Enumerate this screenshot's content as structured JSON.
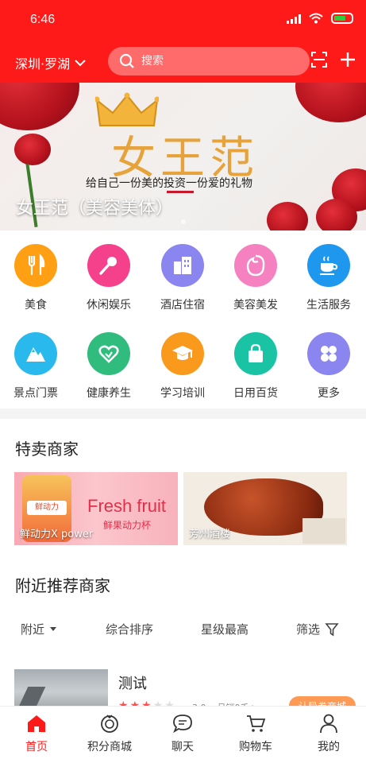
{
  "status": {
    "time": "6:46"
  },
  "header": {
    "city": "深圳·罗湖",
    "search_placeholder": "搜索",
    "icons": [
      "scan-icon",
      "plus-icon"
    ]
  },
  "banner": {
    "headline": "女王范",
    "slogan": "给自己一份美的投资一份爱的礼物",
    "caption": "女王范（美容美体）"
  },
  "categories": [
    {
      "label": "美食",
      "icon": "fork-knife-icon",
      "color": "#ff9f14"
    },
    {
      "label": "休闲娱乐",
      "icon": "microphone-icon",
      "color": "#f5418b"
    },
    {
      "label": "酒店住宿",
      "icon": "building-icon",
      "color": "#8b86ef"
    },
    {
      "label": "美容美发",
      "icon": "face-icon",
      "color": "#f581c1"
    },
    {
      "label": "生活服务",
      "icon": "coffee-cup-icon",
      "color": "#1e98ee"
    },
    {
      "label": "景点门票",
      "icon": "mountain-icon",
      "color": "#29b9ec"
    },
    {
      "label": "健康养生",
      "icon": "heart-icon",
      "color": "#2fbc7d"
    },
    {
      "label": "学习培训",
      "icon": "graduation-cap-icon",
      "color": "#f99a1c"
    },
    {
      "label": "日用百货",
      "icon": "shopping-bag-icon",
      "color": "#19c3a4"
    },
    {
      "label": "更多",
      "icon": "grid-more-icon",
      "color": "#8b86ef"
    }
  ],
  "special": {
    "title": "特卖商家",
    "cards": [
      {
        "label": "鲜动力X power",
        "promo_title": "Fresh fruit",
        "promo_sub": "鲜果动力杯",
        "badge": "鲜动力"
      },
      {
        "label": "芳州酒楼"
      }
    ]
  },
  "nearby": {
    "title": "附近推荐商家",
    "sort": [
      "附近",
      "综合排序",
      "星级最高",
      "筛选"
    ],
    "items": [
      {
        "name": "测试",
        "rating": 3,
        "score": "3.0",
        "sales": "月销0千+",
        "coupon": "认异券商城"
      }
    ]
  },
  "tabbar": [
    {
      "label": "首页",
      "icon": "home-icon",
      "active": true
    },
    {
      "label": "积分商城",
      "icon": "points-icon",
      "active": false
    },
    {
      "label": "聊天",
      "icon": "chat-icon",
      "active": false
    },
    {
      "label": "购物车",
      "icon": "cart-icon",
      "active": false
    },
    {
      "label": "我的",
      "icon": "user-icon",
      "active": false
    }
  ],
  "colors": {
    "brand": "#ff1a1a",
    "active_tab": "#ff1a1a",
    "coupon": "#ff9a55",
    "star": "#ff4d4d"
  }
}
